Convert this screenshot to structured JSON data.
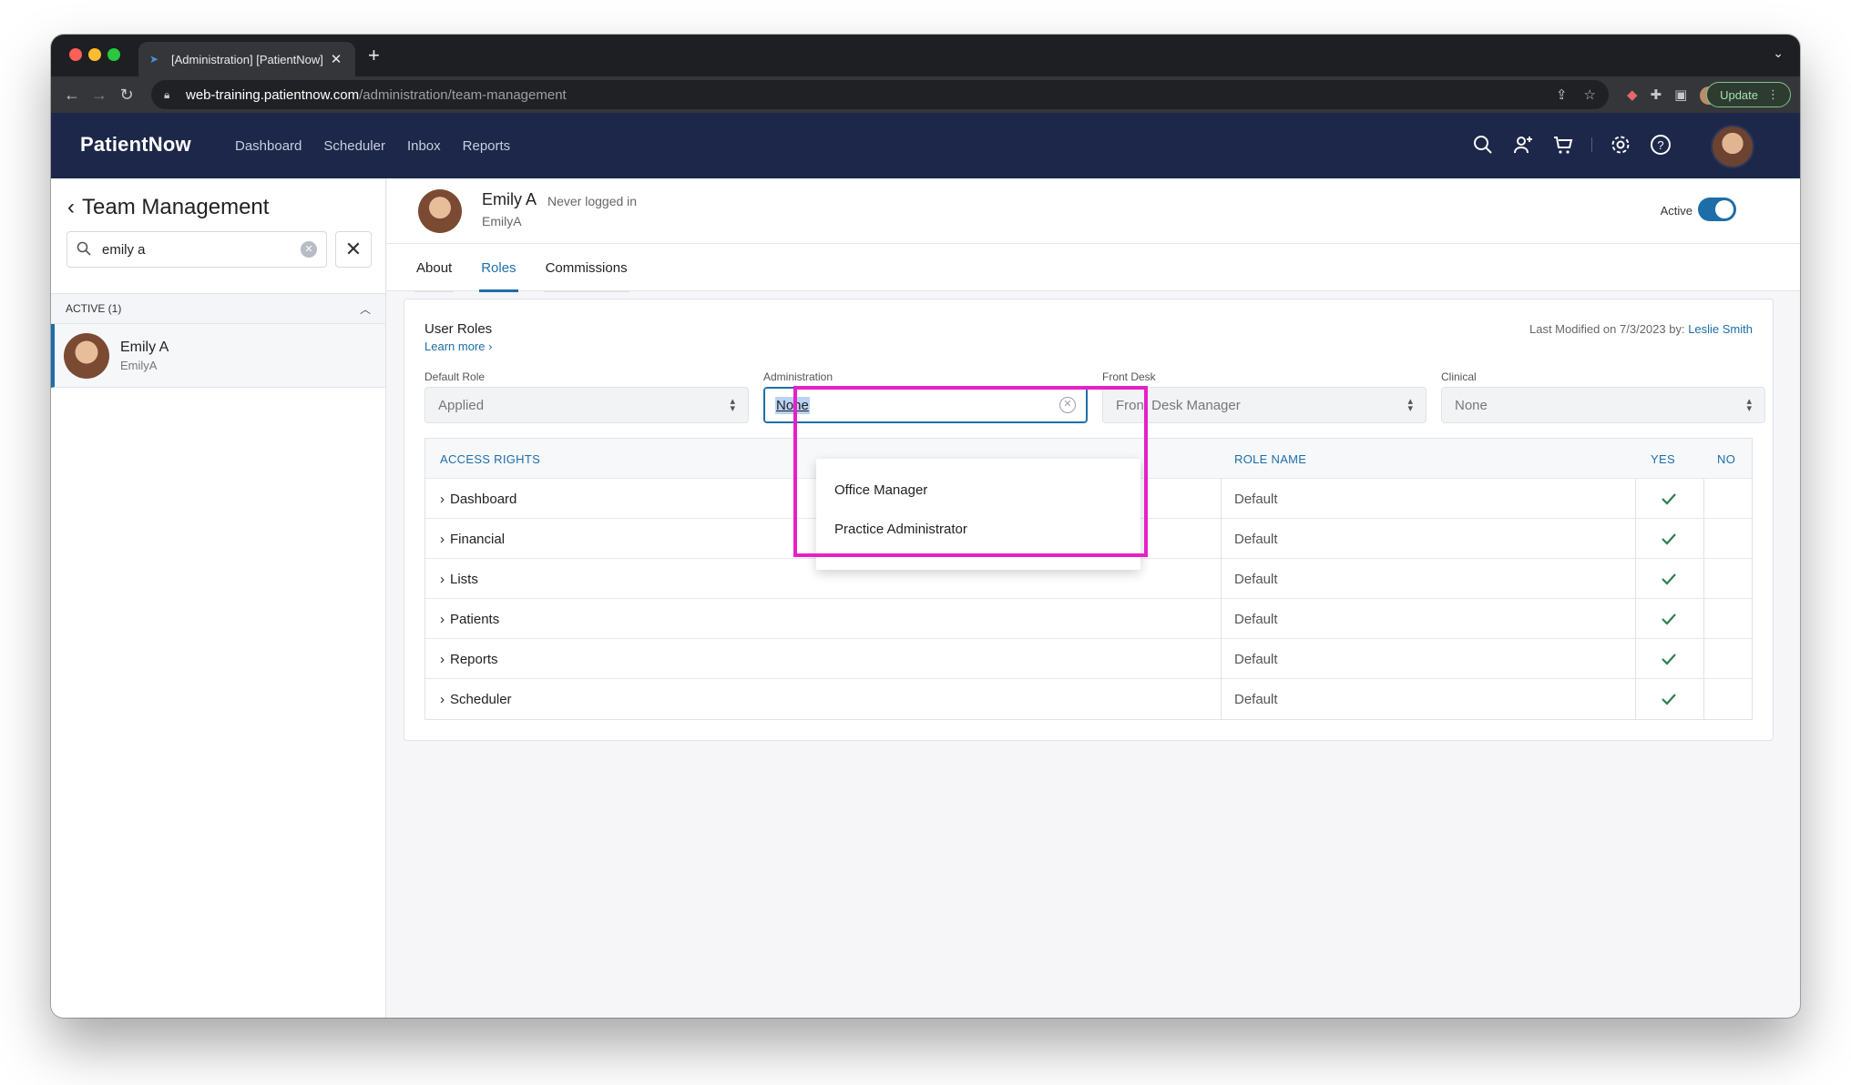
{
  "browser": {
    "tab_title": "[Administration] [PatientNow]",
    "url_host": "web-training.patientnow.com",
    "url_path": "/administration/team-management",
    "update_label": "Update"
  },
  "app": {
    "brand": "PatientNow",
    "nav": [
      "Dashboard",
      "Scheduler",
      "Inbox",
      "Reports"
    ]
  },
  "left_panel": {
    "title": "Team Management",
    "search_value": "emily a",
    "group_label": "ACTIVE (1)",
    "users": [
      {
        "name": "Emily A",
        "username": "EmilyA"
      }
    ]
  },
  "profile": {
    "name": "Emily A",
    "login_status": "Never logged in",
    "username": "EmilyA",
    "active_label": "Active",
    "active": true
  },
  "tabs": [
    "About",
    "Roles",
    "Commissions"
  ],
  "active_tab": "Roles",
  "roles": {
    "title": "User Roles",
    "learn_more": "Learn more",
    "modified_prefix": "Last Modified on 7/3/2023 by:",
    "modified_by": "Leslie Smith",
    "fields": {
      "default_role": {
        "label": "Default Role",
        "value": "Applied"
      },
      "administration": {
        "label": "Administration",
        "value": "None"
      },
      "front_desk": {
        "label": "Front Desk",
        "value": "Front Desk Manager"
      },
      "clinical": {
        "label": "Clinical",
        "value": "None"
      }
    },
    "dropdown_options": [
      "Office Manager",
      "Practice Administrator"
    ],
    "table": {
      "headers": {
        "access": "ACCESS RIGHTS",
        "role": "ROLE NAME",
        "yes": "YES",
        "no": "NO"
      },
      "rows": [
        {
          "name": "Dashboard",
          "role": "Default",
          "yes": true
        },
        {
          "name": "Financial",
          "role": "Default",
          "yes": true
        },
        {
          "name": "Lists",
          "role": "Default",
          "yes": true
        },
        {
          "name": "Patients",
          "role": "Default",
          "yes": true
        },
        {
          "name": "Reports",
          "role": "Default",
          "yes": true
        },
        {
          "name": "Scheduler",
          "role": "Default",
          "yes": true
        }
      ]
    }
  },
  "colors": {
    "app_header": "#1c2749",
    "accent": "#1d6ea8",
    "highlight_box": "#e620c8",
    "check": "#2e7d4f"
  }
}
